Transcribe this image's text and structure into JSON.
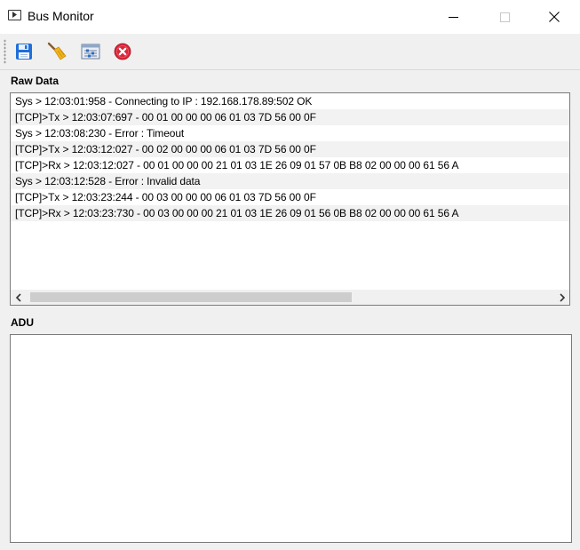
{
  "window": {
    "title": "Bus Monitor"
  },
  "toolbar": {
    "buttons": [
      {
        "name": "save",
        "icon": "floppy-disk-icon"
      },
      {
        "name": "clear",
        "icon": "broom-icon"
      },
      {
        "name": "filter",
        "icon": "filter-settings-icon"
      },
      {
        "name": "stop",
        "icon": "stop-icon"
      }
    ]
  },
  "raw_data": {
    "label": "Raw Data",
    "rows": [
      "Sys > 12:03:01:958 - Connecting to IP : 192.168.178.89:502 OK",
      "[TCP]>Tx > 12:03:07:697 - 00  01  00  00  00  06  01  03  7D  56  00  0F",
      "Sys > 12:03:08:230 - Error : Timeout",
      "[TCP]>Tx > 12:03:12:027 - 00  02  00  00  00  06  01  03  7D  56  00  0F",
      "[TCP]>Rx > 12:03:12:027 - 00  01  00  00  00  21  01  03  1E  26  09  01  57  0B  B8  02  00  00  00  61  56  A",
      "Sys > 12:03:12:528 - Error : Invalid data",
      "[TCP]>Tx > 12:03:23:244 - 00  03  00  00  00  06  01  03  7D  56  00  0F",
      "[TCP]>Rx > 12:03:23:730 - 00  03  00  00  00  21  01  03  1E  26  09  01  56  0B  B8  02  00  00  00  61  56  A"
    ]
  },
  "adu": {
    "label": "ADU"
  },
  "colors": {
    "save_blue": "#1e6fd9",
    "stop_red": "#d9283a",
    "broom_yellow": "#f2b51c"
  }
}
